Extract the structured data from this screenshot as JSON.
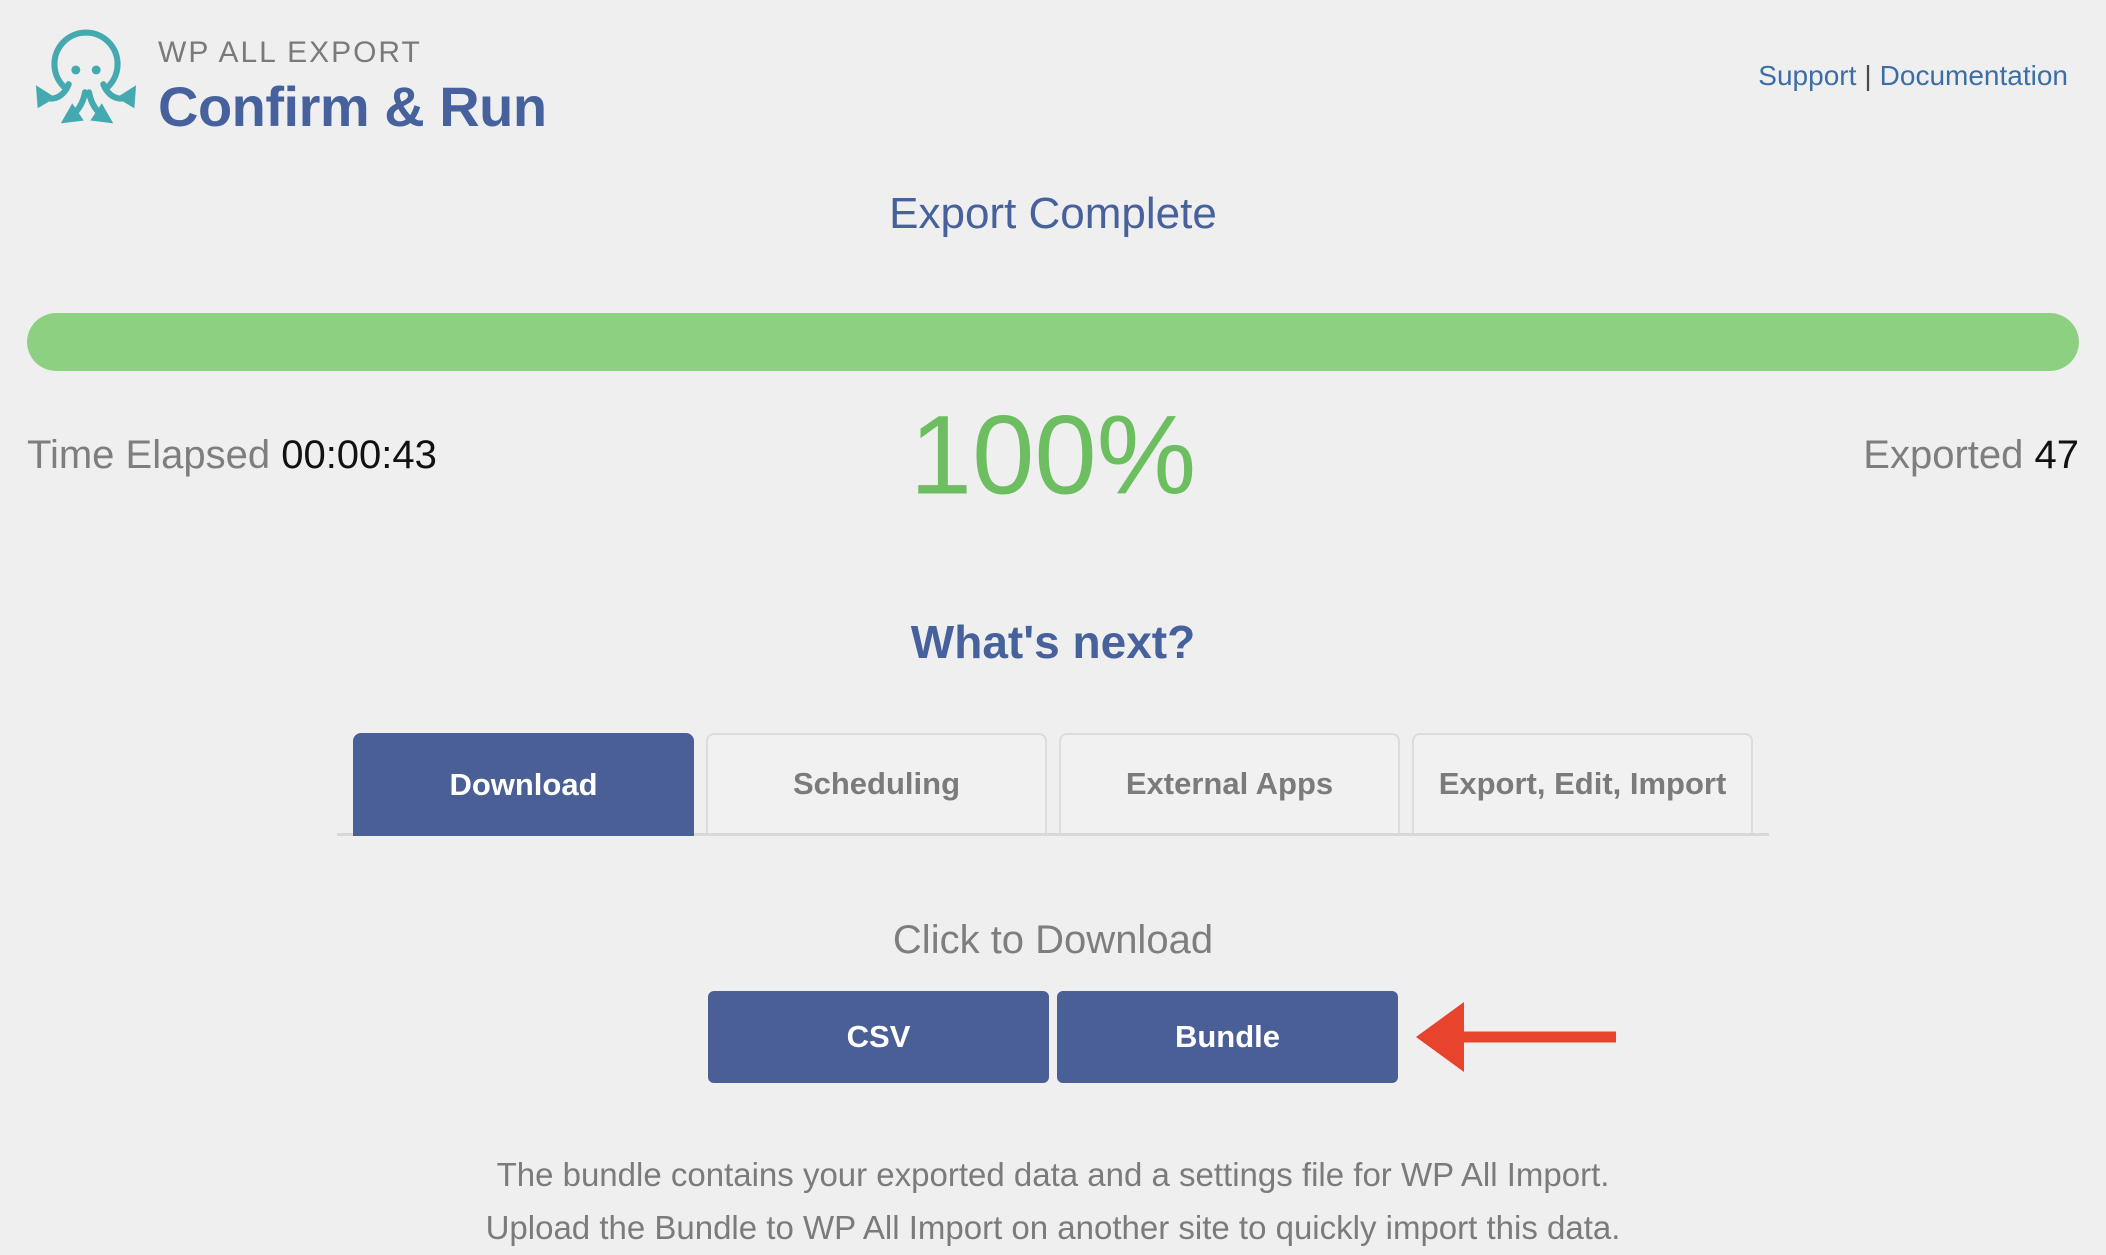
{
  "header": {
    "brand_line1": "WP ALL EXPORT",
    "brand_line2": "Confirm & Run",
    "links": {
      "support": "Support",
      "documentation": "Documentation"
    },
    "link_separator": "|"
  },
  "status": {
    "title": "Export Complete",
    "time_elapsed_label": "Time Elapsed",
    "time_elapsed_value": "00:00:43",
    "percent": "100%",
    "progress_percent_complete": 100,
    "exported_label": "Exported",
    "exported_value": "47"
  },
  "whats_next": {
    "title": "What's next?",
    "tabs": [
      {
        "label": "Download",
        "active": true
      },
      {
        "label": "Scheduling",
        "active": false
      },
      {
        "label": "External Apps",
        "active": false
      },
      {
        "label": "Export, Edit, Import",
        "active": false
      }
    ]
  },
  "download_section": {
    "heading": "Click to Download",
    "buttons": [
      {
        "label": "CSV"
      },
      {
        "label": "Bundle"
      }
    ],
    "note_line1": "The bundle contains your exported data and a settings file for WP All Import.",
    "note_line2": "Upload the Bundle to WP All Import on another site to quickly import this data."
  },
  "icons": {
    "logo": "octopus-export-logo",
    "arrow": "red-arrow-pointing-left-at-bundle"
  },
  "colors": {
    "background": "#efeff0",
    "heading_blue": "#46619c",
    "button_blue": "#4a5f96",
    "progress_green": "#8ed081",
    "percent_green": "#6dbd61",
    "link_blue": "#3a6ea5",
    "gray_text": "#7b7b7b",
    "logo_teal": "#45aab0",
    "arrow_red": "#e8432c"
  }
}
